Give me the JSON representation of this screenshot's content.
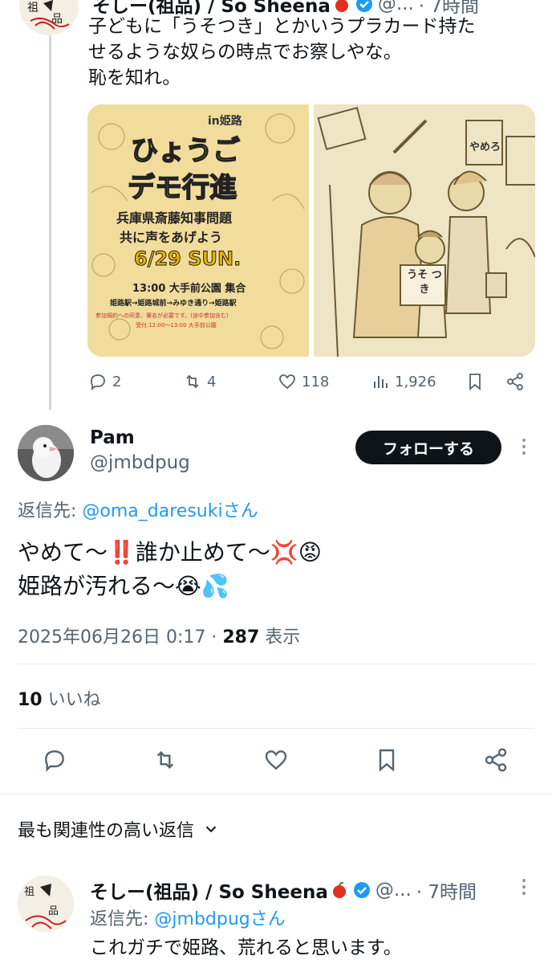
{
  "top_tweet": {
    "name": "そしー(祖品) / So Sheena",
    "handle": "@...",
    "time": "· 7時間",
    "text_lines": [
      "子どもに「うそつき」とかいうプラカード持た",
      "せるような奴らの時点でお察しやな。",
      "恥を知れ。"
    ],
    "poster": {
      "tag": "in姫路",
      "title1": "ひょうご",
      "title2": "デモ行進",
      "subtitle1": "兵庫県斎藤知事問題",
      "subtitle2": "共に声をあげよう",
      "date": "6/29 SUN.",
      "meeting": "13:00 大手前公園 集合",
      "route": "姫路駅→姫路城前→みゆき通り→姫路駅",
      "notes": "参加規約への同意、署名が必要です。(途中参加含む)",
      "reception": "受付.12:00〜13:00 大手前公園"
    },
    "illustration": {
      "sign1": "やめろ",
      "sign2": "うそ つき"
    },
    "actions": {
      "replies": "2",
      "retweets": "4",
      "likes": "118",
      "views": "1,926"
    }
  },
  "main_tweet": {
    "name": "Pam",
    "handle": "@jmbdpug",
    "follow_label": "フォローする",
    "reply_to_prefix": "返信先: ",
    "reply_to_handle": "@oma_daresukiさん",
    "line1": "やめて〜‼️誰か止めて〜💢😡",
    "line2": "姫路が汚れる〜😭💦",
    "timestamp": "2025年06月26日 0:17 · ",
    "views_count": "287",
    "views_label": " 表示",
    "likes_count": "10",
    "likes_label": " いいね"
  },
  "replies_header": {
    "label": "最も関連性の高い返信"
  },
  "bottom_tweet": {
    "name": "そしー(祖品) / So Sheena",
    "handle": "@...",
    "time": "· 7時間",
    "reply_to_prefix": "返信先: ",
    "reply_to_handle": "@jmbdpugさん",
    "text": "これガチで姫路、荒れると思います。"
  },
  "colors": {
    "accent": "#1d9bf0",
    "text": "#0f1419",
    "muted": "#536471",
    "poster_bg": "#f1dc9c"
  }
}
